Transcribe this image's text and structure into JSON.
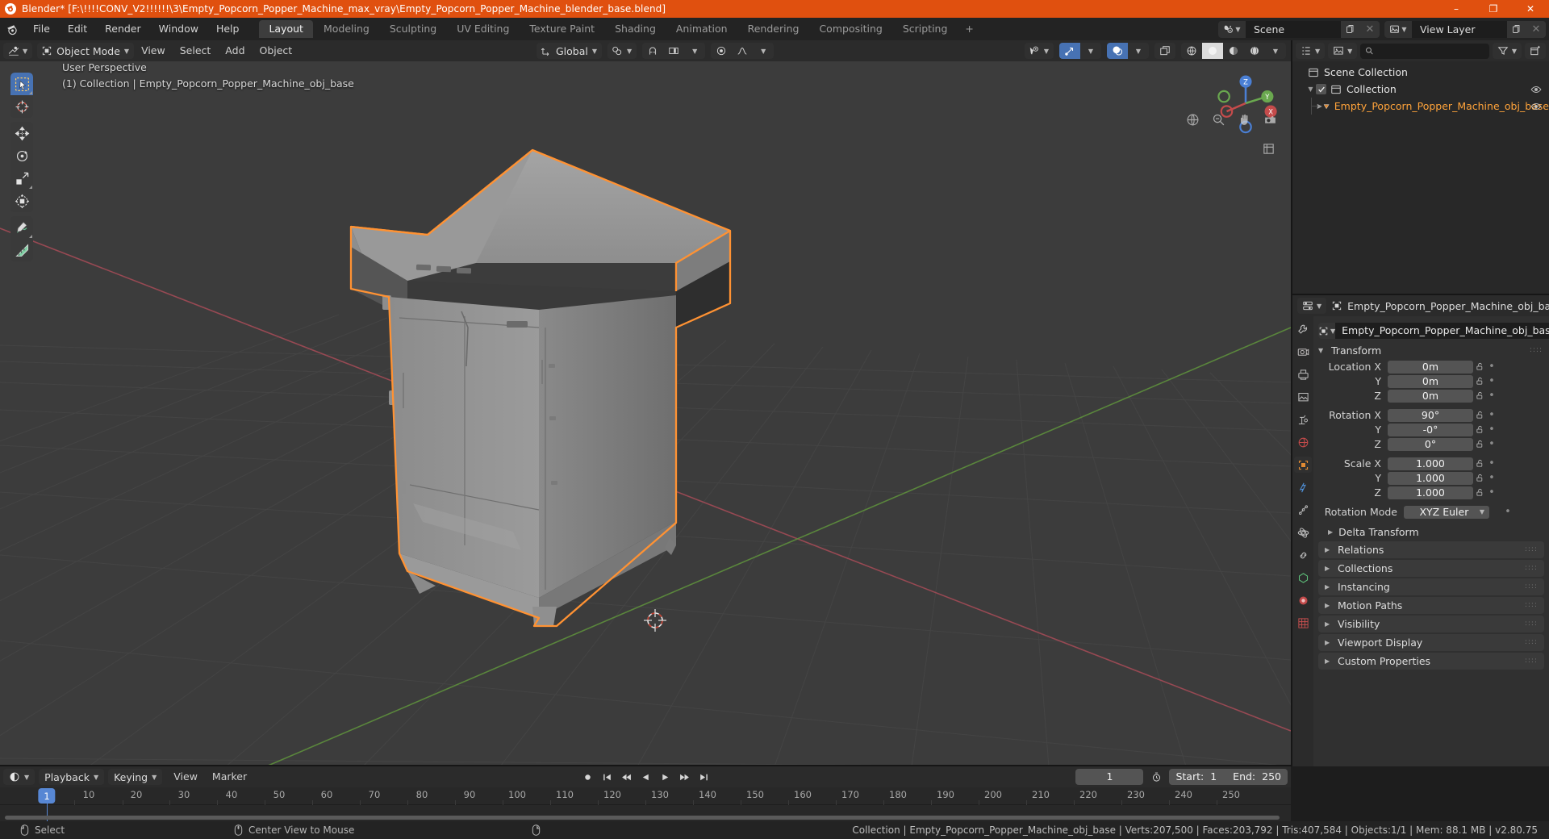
{
  "titlebar": {
    "text": "Blender* [F:\\!!!!CONV_V2!!!!!!\\3\\Empty_Popcorn_Popper_Machine_max_vray\\Empty_Popcorn_Popper_Machine_blender_base.blend]",
    "minimize": "–",
    "maximize": "❐",
    "close": "✕",
    "accent_color": "#e0500f"
  },
  "menubar": {
    "items": [
      "File",
      "Edit",
      "Render",
      "Window",
      "Help"
    ],
    "workspaces": [
      {
        "label": "Layout",
        "active": true
      },
      {
        "label": "Modeling",
        "active": false
      },
      {
        "label": "Sculpting",
        "active": false
      },
      {
        "label": "UV Editing",
        "active": false
      },
      {
        "label": "Texture Paint",
        "active": false
      },
      {
        "label": "Shading",
        "active": false
      },
      {
        "label": "Animation",
        "active": false
      },
      {
        "label": "Rendering",
        "active": false
      },
      {
        "label": "Compositing",
        "active": false
      },
      {
        "label": "Scripting",
        "active": false
      }
    ],
    "add_workspace": "+",
    "scene_name": "Scene",
    "viewlayer_name": "View Layer"
  },
  "viewport_header": {
    "mode": "Object Mode",
    "menus": [
      "View",
      "Select",
      "Add",
      "Object"
    ],
    "transform_orientation": "Global"
  },
  "viewport": {
    "perspective_label": "User Perspective",
    "object_label": "(1) Collection | Empty_Popcorn_Popper_Machine_obj_base",
    "gizmo_axes": {
      "x": "X",
      "y": "Y",
      "z": "Z"
    },
    "selection_outline_color": "#ff9233",
    "background_color": "#3c3c3c"
  },
  "toolbar": {
    "tools": [
      {
        "name": "tweak-tool",
        "active": true
      },
      {
        "name": "cursor-tool",
        "active": false
      },
      {
        "name": "move-tool",
        "active": false
      },
      {
        "name": "rotate-tool",
        "active": false
      },
      {
        "name": "scale-tool",
        "active": false
      },
      {
        "name": "transform-tool",
        "active": false
      },
      {
        "name": "annotate-tool",
        "active": false
      },
      {
        "name": "measure-tool",
        "active": false
      }
    ]
  },
  "outliner": {
    "search_placeholder": "",
    "rows": [
      {
        "label": "Scene Collection",
        "icon": "collection-icon",
        "indent": 0,
        "selected": false,
        "checkbox": false,
        "eye": false,
        "disclosure": ""
      },
      {
        "label": "Collection",
        "icon": "collection-icon",
        "indent": 1,
        "selected": false,
        "checkbox": true,
        "eye": true,
        "disclosure": "▼"
      },
      {
        "label": "Empty_Popcorn_Popper_Machine_obj_base",
        "icon": "mesh-object-icon",
        "indent": 2,
        "selected": true,
        "checkbox": false,
        "eye": true,
        "disclosure": "▶"
      }
    ]
  },
  "properties": {
    "breadcrumb_object": "Empty_Popcorn_Popper_Machine_obj_base",
    "object_name_field": "Empty_Popcorn_Popper_Machine_obj_base",
    "transform_panel": "Transform",
    "fields": [
      {
        "label": "Location X",
        "value": "0m"
      },
      {
        "label": "Y",
        "value": "0m"
      },
      {
        "label": "Z",
        "value": "0m"
      },
      {
        "label": "Rotation X",
        "value": "90°"
      },
      {
        "label": "Y",
        "value": "-0°"
      },
      {
        "label": "Z",
        "value": "0°"
      },
      {
        "label": "Scale X",
        "value": "1.000"
      },
      {
        "label": "Y",
        "value": "1.000"
      },
      {
        "label": "Z",
        "value": "1.000"
      }
    ],
    "rotation_mode_label": "Rotation Mode",
    "rotation_mode_value": "XYZ Euler",
    "delta_transform": "Delta Transform",
    "panels": [
      "Relations",
      "Collections",
      "Instancing",
      "Motion Paths",
      "Visibility",
      "Viewport Display",
      "Custom Properties"
    ]
  },
  "timeline": {
    "editor_label": "",
    "menus": [
      "Playback",
      "Keying",
      "View",
      "Marker"
    ],
    "current_frame": "1",
    "start_label": "Start:",
    "start_value": "1",
    "end_label": "End:",
    "end_value": "250",
    "ticks": [
      "1",
      "10",
      "20",
      "30",
      "40",
      "50",
      "60",
      "70",
      "80",
      "90",
      "100",
      "110",
      "120",
      "130",
      "140",
      "150",
      "160",
      "170",
      "180",
      "190",
      "200",
      "210",
      "220",
      "230",
      "240",
      "250"
    ],
    "playhead_frame": "1"
  },
  "statusbar": {
    "hints": [
      {
        "icon": "mouse-left-icon",
        "label": "Select"
      },
      {
        "icon": "mouse-middle-icon",
        "label": "Center View to Mouse"
      },
      {
        "icon": "mouse-right-icon",
        "label": ""
      }
    ],
    "stats": "Collection | Empty_Popcorn_Popper_Machine_obj_base | Verts:207,500 | Faces:203,792 | Tris:407,584 | Objects:1/1 | Mem: 88.1 MB | v2.80.75"
  }
}
